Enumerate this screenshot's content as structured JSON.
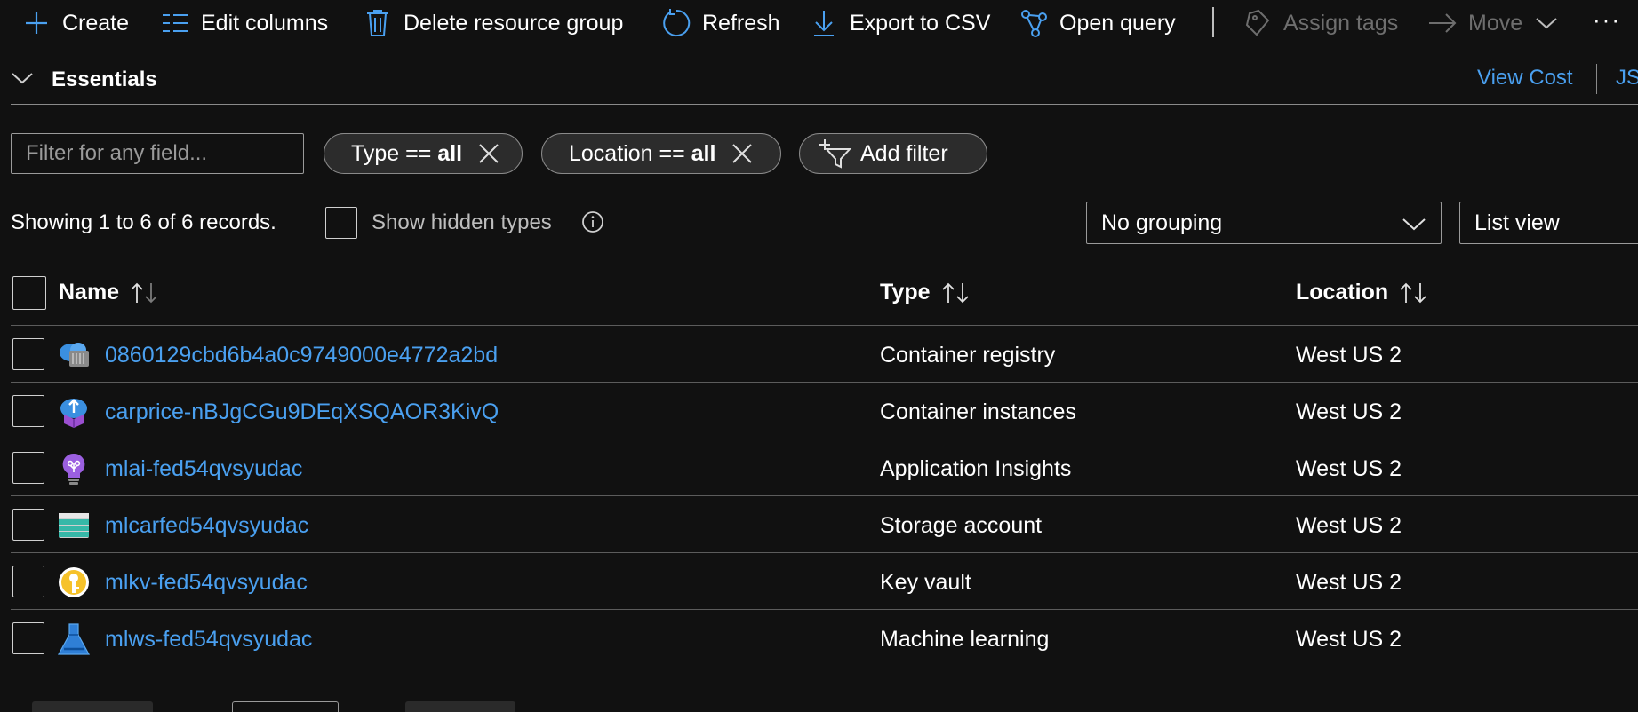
{
  "toolbar": {
    "create": "Create",
    "edit_columns": "Edit columns",
    "delete_group": "Delete resource group",
    "refresh": "Refresh",
    "export_csv": "Export to CSV",
    "open_query": "Open query",
    "assign_tags": "Assign tags",
    "move": "Move",
    "more": "···"
  },
  "essentials": {
    "title": "Essentials",
    "view_cost": "View Cost",
    "json": "JS"
  },
  "filter": {
    "placeholder": "Filter for any field...",
    "type_prefix": "Type == ",
    "type_value": "all",
    "location_prefix": "Location == ",
    "location_value": "all",
    "add_filter": "Add filter"
  },
  "status": {
    "records": "Showing 1 to 6 of 6 records.",
    "show_hidden": "Show hidden types",
    "grouping": "No grouping",
    "view": "List view"
  },
  "table": {
    "headers": {
      "name": "Name",
      "type": "Type",
      "location": "Location"
    },
    "rows": [
      {
        "name": "0860129cbd6b4a0c9749000e4772a2bd",
        "type": "Container registry",
        "location": "West US 2",
        "icon": "container-registry-icon"
      },
      {
        "name": "carprice-nBJgCGu9DEqXSQAOR3KivQ",
        "type": "Container instances",
        "location": "West US 2",
        "icon": "container-instances-icon"
      },
      {
        "name": "mlai-fed54qvsyudac",
        "type": "Application Insights",
        "location": "West US 2",
        "icon": "application-insights-icon"
      },
      {
        "name": "mlcarfed54qvsyudac",
        "type": "Storage account",
        "location": "West US 2",
        "icon": "storage-account-icon"
      },
      {
        "name": "mlkv-fed54qvsyudac",
        "type": "Key vault",
        "location": "West US 2",
        "icon": "key-vault-icon"
      },
      {
        "name": "mlws-fed54qvsyudac",
        "type": "Machine learning",
        "location": "West US 2",
        "icon": "machine-learning-icon"
      }
    ]
  },
  "colors": {
    "background": "#111111",
    "link": "#4aa0f0",
    "accent_icon": "#4aa0f0",
    "disabled": "#6e6e6e"
  }
}
